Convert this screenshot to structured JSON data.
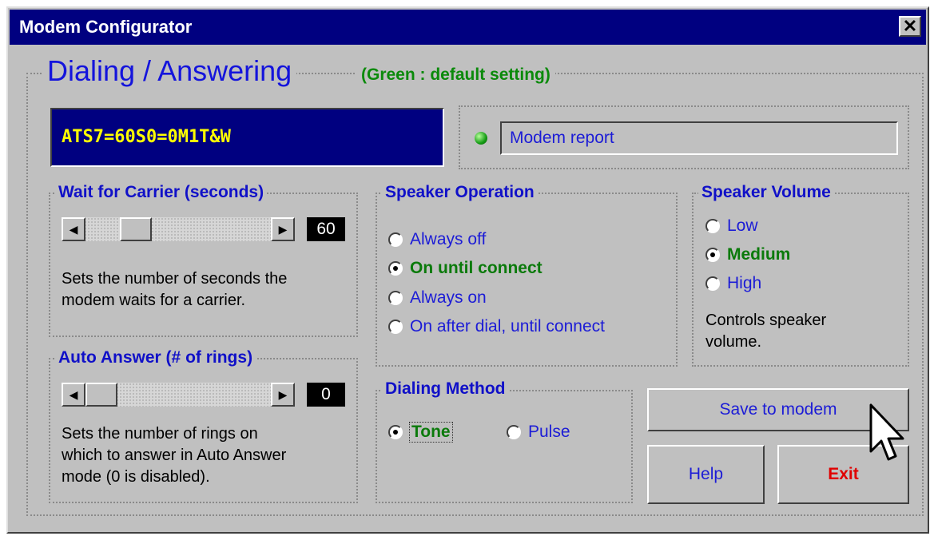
{
  "window": {
    "title": "Modem Configurator",
    "close_label": "✕"
  },
  "section": {
    "title": "Dialing / Answering",
    "note": "(Green : default setting)"
  },
  "command": {
    "text": "ATS7=60S0=0M1T&W"
  },
  "report": {
    "text": "Modem report",
    "led_color": "#149b14"
  },
  "wait_carrier": {
    "label": "Wait for Carrier (seconds)",
    "value": "60",
    "slider_fraction": 0.2,
    "description_line1": "Sets the number of seconds the",
    "description_line2": "modem waits for a carrier."
  },
  "auto_answer": {
    "label": "Auto Answer (# of rings)",
    "value": "0",
    "slider_fraction": 0,
    "description_line1": "Sets the number of rings on",
    "description_line2": "which to answer in Auto Answer",
    "description_line3": "mode (0 is disabled)."
  },
  "speaker_operation": {
    "label": "Speaker Operation",
    "options": [
      {
        "label": "Always off",
        "checked": false
      },
      {
        "label": "On until connect",
        "checked": true
      },
      {
        "label": "Always on",
        "checked": false
      },
      {
        "label": "On after dial, until connect",
        "checked": false
      }
    ]
  },
  "speaker_volume": {
    "label": "Speaker Volume",
    "options": [
      {
        "label": "Low",
        "checked": false
      },
      {
        "label": "Medium",
        "checked": true
      },
      {
        "label": "High",
        "checked": false
      }
    ],
    "description_line1": "Controls speaker",
    "description_line2": "volume."
  },
  "dialing_method": {
    "label": "Dialing Method",
    "options": [
      {
        "label": "Tone",
        "checked": true
      },
      {
        "label": "Pulse",
        "checked": false
      }
    ]
  },
  "buttons": {
    "save": "Save to modem",
    "help": "Help",
    "exit": "Exit"
  },
  "colors": {
    "title_bar": "#000080",
    "label_blue": "#1010c8",
    "default_green": "#0b8a0b",
    "exit_red": "#e00000"
  }
}
